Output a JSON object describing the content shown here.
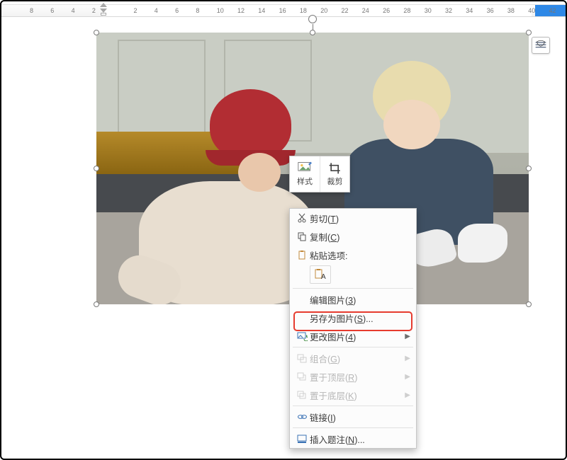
{
  "ruler": {
    "ticks": [
      8,
      6,
      4,
      2,
      "",
      2,
      4,
      6,
      8,
      10,
      12,
      14,
      16,
      18,
      20,
      22,
      24,
      26,
      28,
      30,
      32,
      34,
      36,
      38,
      40,
      42
    ]
  },
  "mini_toolbar": {
    "style_label": "样式",
    "crop_label": "裁剪"
  },
  "context_menu": {
    "cut": {
      "label": "剪切(",
      "hotkey": "T",
      "suffix": ")"
    },
    "copy": {
      "label": "复制(",
      "hotkey": "C",
      "suffix": ")"
    },
    "paste_opts_label": "粘贴选项:",
    "edit_image": {
      "label": "编辑图片(",
      "hotkey": "3",
      "suffix": ")"
    },
    "save_as": {
      "label": "另存为图片(",
      "hotkey": "S",
      "suffix": ")..."
    },
    "change_img": {
      "label": "更改图片(",
      "hotkey": "4",
      "suffix": ")"
    },
    "group": {
      "label": "组合(",
      "hotkey": "G",
      "suffix": ")"
    },
    "bring_front": {
      "label": "置于顶层(",
      "hotkey": "R",
      "suffix": ")"
    },
    "send_back": {
      "label": "置于底层(",
      "hotkey": "K",
      "suffix": ")"
    },
    "link": {
      "label": "链接(",
      "hotkey": "I",
      "suffix": ")"
    },
    "caption": {
      "label": "插入题注(",
      "hotkey": "N",
      "suffix": ")..."
    }
  }
}
